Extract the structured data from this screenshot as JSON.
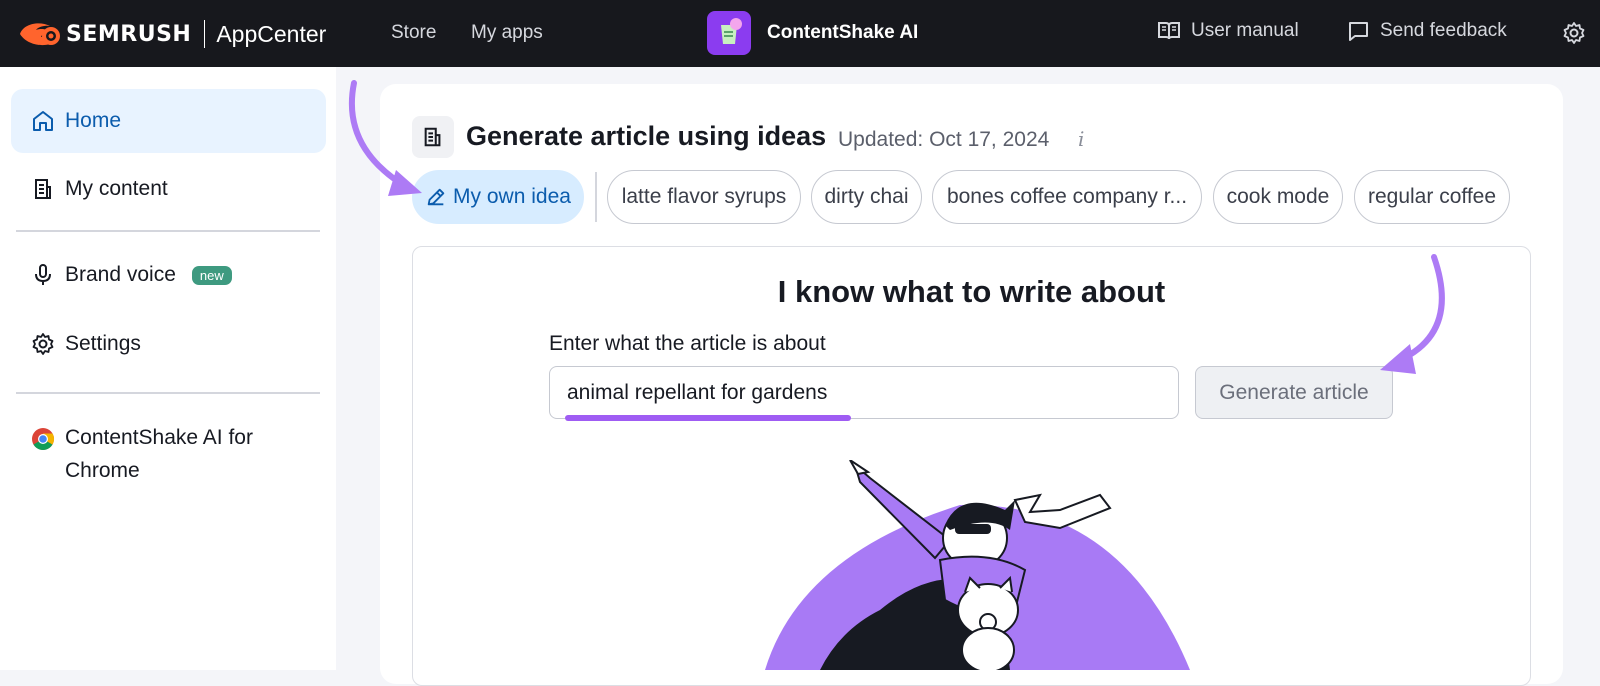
{
  "topbar": {
    "brand": "SEMRUSH",
    "brand_app": "AppCenter",
    "nav": [
      "Store",
      "My apps"
    ],
    "app_name": "ContentShake AI",
    "user_manual": "User manual",
    "send_feedback": "Send feedback",
    "icons": {
      "brand": "semrush-flame-logo",
      "manual": "book-icon",
      "feedback": "chat-bubble-icon",
      "settings": "gear-icon"
    }
  },
  "sidebar": {
    "items": [
      {
        "label": "Home",
        "icon": "home-icon",
        "active": true
      },
      {
        "label": "My content",
        "icon": "document-icon"
      },
      {
        "label": "Brand voice",
        "icon": "microphone-icon",
        "badge": "new"
      },
      {
        "label": "Settings",
        "icon": "gear-icon"
      }
    ],
    "chrome_item": "ContentShake AI for Chrome"
  },
  "main": {
    "title": "Generate article using ideas",
    "updated": "Updated: Oct 17, 2024",
    "info": "i",
    "chips": [
      "My own idea",
      "latte flavor syrups",
      "dirty chai",
      "bones coffee company r...",
      "cook mode",
      "regular coffee"
    ],
    "panel_heading": "I know what to write about",
    "input_label": "Enter what the article is about",
    "input_value": "animal repellant for gardens",
    "generate_button": "Generate article"
  },
  "colors": {
    "accent": "#0b5cad",
    "highlight": "#9f5cf3",
    "topbar": "#17181d",
    "badge": "#3e9a80"
  }
}
